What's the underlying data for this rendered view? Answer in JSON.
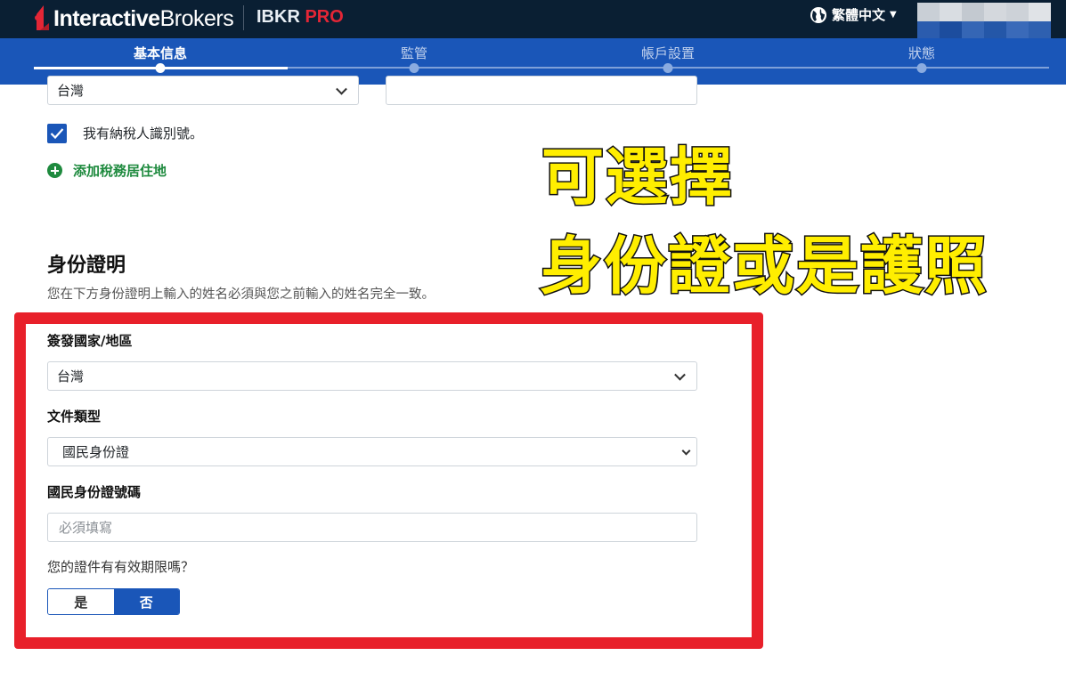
{
  "header": {
    "brand_prefix": "Interactive",
    "brand_suffix": "Brokers",
    "product": "IBKR",
    "product_accent": "PRO",
    "language": "繁體中文"
  },
  "steps": [
    {
      "label": "基本信息",
      "active": true
    },
    {
      "label": "監管",
      "active": false
    },
    {
      "label": "帳戶設置",
      "active": false
    },
    {
      "label": "狀態",
      "active": false
    }
  ],
  "tax": {
    "country_value": "台灣",
    "tin_value": "",
    "has_tin_label": "我有納稅人識別號。",
    "has_tin_checked": true,
    "add_residence_label": "添加稅務居住地"
  },
  "identity": {
    "title": "身份證明",
    "description": "您在下方身份證明上輸入的姓名必須與您之前輸入的姓名完全一致。",
    "issuing_country_label": "簽發國家/地區",
    "issuing_country_value": "台灣",
    "doc_type_label": "文件類型",
    "doc_type_value": "國民身份證",
    "id_number_label": "國民身份證號碼",
    "id_number_placeholder": "必須填寫",
    "expiry_question": "您的證件有有效期限嗎？",
    "yes_label": "是",
    "no_label": "否",
    "selected": "否"
  },
  "overlay": {
    "line1": "可選擇",
    "line2": "身份證或是護照"
  },
  "colors": {
    "topbar": "#0a1f33",
    "stepper": "#1a56b8",
    "highlight": "#e8202a",
    "overlay_text": "#ffee00",
    "link_green": "#1e8a3e",
    "accent_red": "#e32636"
  }
}
